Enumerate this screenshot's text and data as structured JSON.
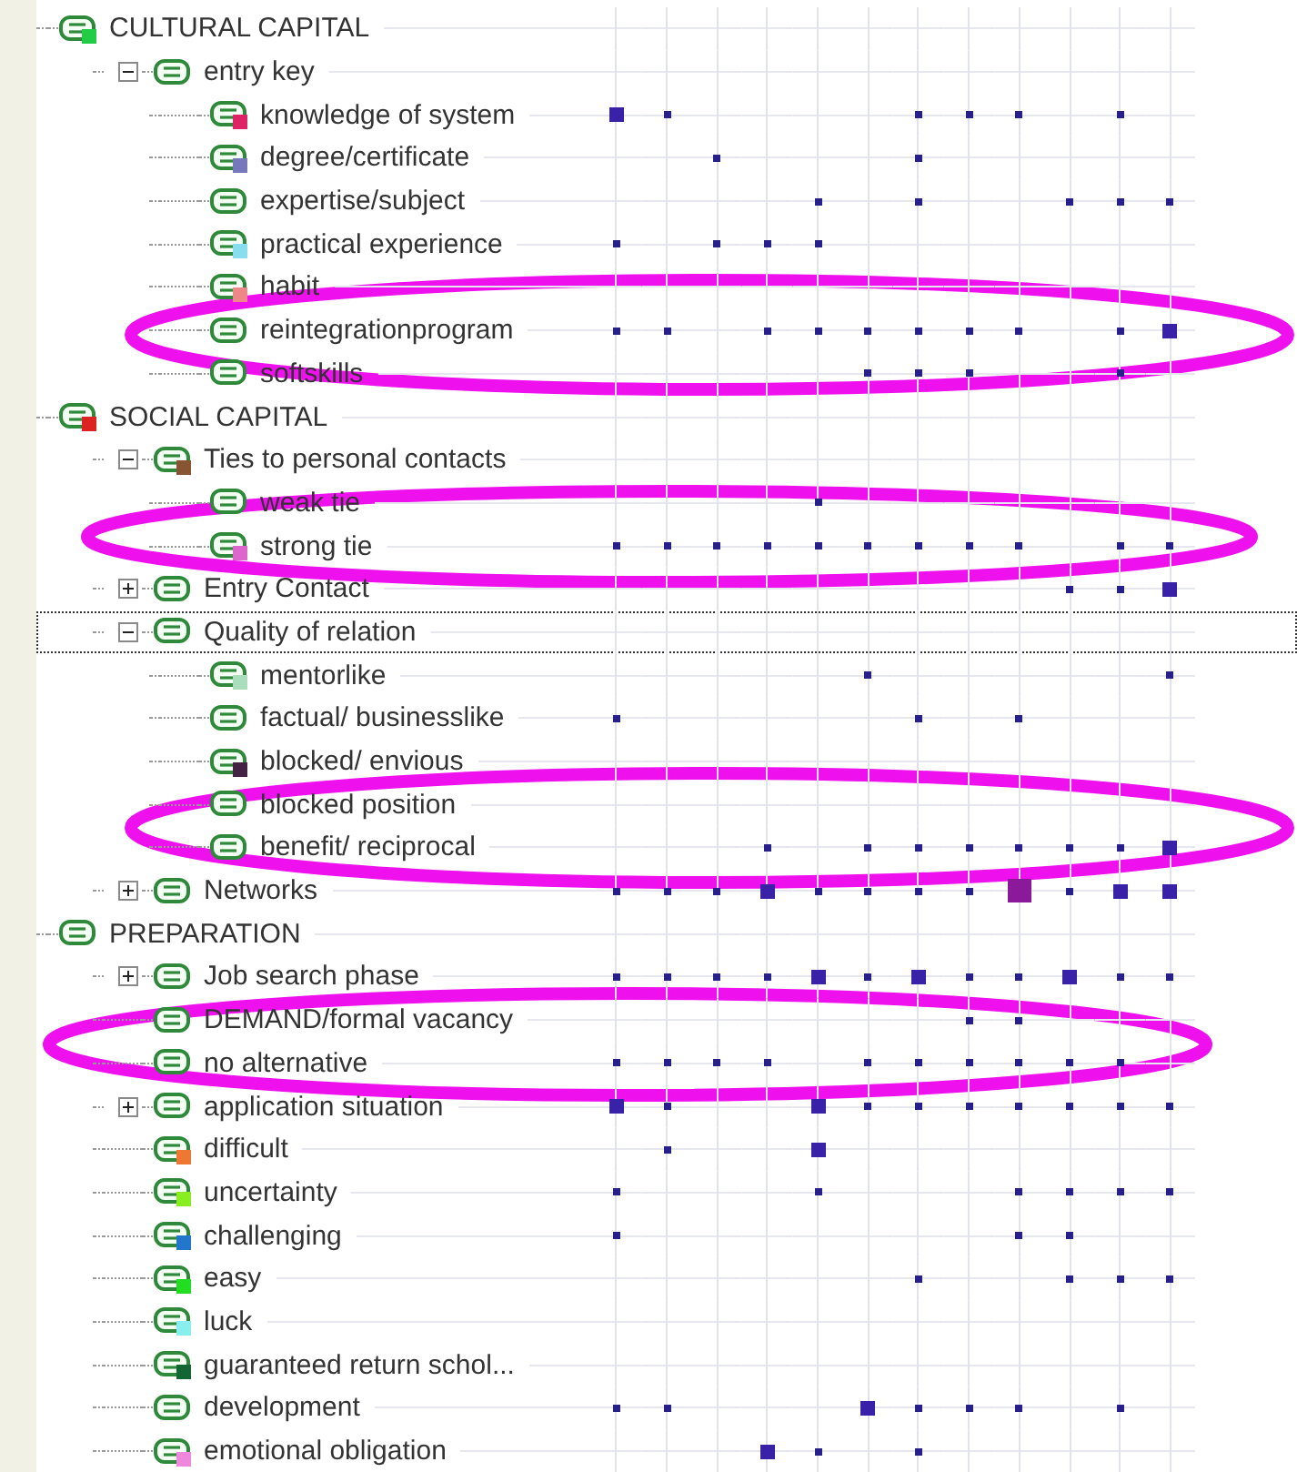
{
  "tree": [
    {
      "label": "CULTURAL CAPITAL",
      "color": "#22cc44",
      "selected": false,
      "children": [
        {
          "label": "entry key",
          "selected": false,
          "expanded": true,
          "children": [
            {
              "label": "knowledge of system",
              "color": "#dd2266",
              "selected": false,
              "cells": [
                {
                  "kind": "medium"
                },
                {
                  "kind": "small"
                },
                {
                  "kind": "none"
                },
                {
                  "kind": "none"
                },
                {
                  "kind": "none"
                },
                {
                  "kind": "none"
                },
                {
                  "kind": "small"
                },
                {
                  "kind": "small"
                },
                {
                  "kind": "small"
                },
                {
                  "kind": "none"
                },
                {
                  "kind": "small"
                },
                {
                  "kind": "none"
                }
              ]
            },
            {
              "label": "degree/certificate",
              "color": "#7777bb",
              "selected": false,
              "cells": [
                {
                  "kind": "none"
                },
                {
                  "kind": "none"
                },
                {
                  "kind": "small"
                },
                {
                  "kind": "none"
                },
                {
                  "kind": "none"
                },
                {
                  "kind": "none"
                },
                {
                  "kind": "small"
                },
                {
                  "kind": "none"
                },
                {
                  "kind": "none"
                },
                {
                  "kind": "none"
                },
                {
                  "kind": "none"
                },
                {
                  "kind": "none"
                }
              ]
            },
            {
              "label": "expertise/subject",
              "selected": false,
              "cells": [
                {
                  "kind": "none"
                },
                {
                  "kind": "none"
                },
                {
                  "kind": "none"
                },
                {
                  "kind": "none"
                },
                {
                  "kind": "small"
                },
                {
                  "kind": "none"
                },
                {
                  "kind": "small"
                },
                {
                  "kind": "none"
                },
                {
                  "kind": "none"
                },
                {
                  "kind": "small"
                },
                {
                  "kind": "small"
                },
                {
                  "kind": "small"
                }
              ]
            },
            {
              "label": "practical experience",
              "color": "#88ddee",
              "selected": false,
              "cells": [
                {
                  "kind": "small"
                },
                {
                  "kind": "none"
                },
                {
                  "kind": "small"
                },
                {
                  "kind": "small"
                },
                {
                  "kind": "small"
                },
                {
                  "kind": "none"
                },
                {
                  "kind": "none"
                },
                {
                  "kind": "none"
                },
                {
                  "kind": "none"
                },
                {
                  "kind": "none"
                },
                {
                  "kind": "none"
                },
                {
                  "kind": "none"
                }
              ]
            },
            {
              "label": "habit",
              "color": "#ee8888",
              "selected": false
            },
            {
              "label": "reintegrationprogram",
              "selected": false,
              "cells": [
                {
                  "kind": "small"
                },
                {
                  "kind": "small"
                },
                {
                  "kind": "none"
                },
                {
                  "kind": "small"
                },
                {
                  "kind": "small"
                },
                {
                  "kind": "small"
                },
                {
                  "kind": "small"
                },
                {
                  "kind": "small"
                },
                {
                  "kind": "small"
                },
                {
                  "kind": "none"
                },
                {
                  "kind": "small"
                },
                {
                  "kind": "medium"
                }
              ]
            },
            {
              "label": "softskills",
              "selected": false,
              "cells": [
                {
                  "kind": "none"
                },
                {
                  "kind": "none"
                },
                {
                  "kind": "none"
                },
                {
                  "kind": "none"
                },
                {
                  "kind": "none"
                },
                {
                  "kind": "small"
                },
                {
                  "kind": "small"
                },
                {
                  "kind": "small"
                },
                {
                  "kind": "none"
                },
                {
                  "kind": "none"
                },
                {
                  "kind": "small"
                },
                {
                  "kind": "none"
                }
              ]
            }
          ]
        }
      ]
    },
    {
      "label": "SOCIAL CAPITAL",
      "color": "#dd2222",
      "selected": false,
      "children": [
        {
          "label": "Ties to personal contacts",
          "color": "#885533",
          "selected": false,
          "expanded": true,
          "children": [
            {
              "label": "weak tie",
              "selected": false,
              "cells": [
                {
                  "kind": "none"
                },
                {
                  "kind": "none"
                },
                {
                  "kind": "none"
                },
                {
                  "kind": "none"
                },
                {
                  "kind": "small"
                },
                {
                  "kind": "none"
                },
                {
                  "kind": "none"
                },
                {
                  "kind": "none"
                },
                {
                  "kind": "none"
                },
                {
                  "kind": "none"
                },
                {
                  "kind": "none"
                },
                {
                  "kind": "none"
                }
              ]
            },
            {
              "label": "strong tie",
              "color": "#dd66cc",
              "selected": false,
              "cells": [
                {
                  "kind": "small"
                },
                {
                  "kind": "small"
                },
                {
                  "kind": "small"
                },
                {
                  "kind": "small"
                },
                {
                  "kind": "small"
                },
                {
                  "kind": "small"
                },
                {
                  "kind": "small"
                },
                {
                  "kind": "small"
                },
                {
                  "kind": "small"
                },
                {
                  "kind": "none"
                },
                {
                  "kind": "small"
                },
                {
                  "kind": "small"
                }
              ]
            }
          ]
        },
        {
          "label": "Entry Contact",
          "selected": false,
          "expanded": false,
          "cells": [
            {
              "kind": "none"
            },
            {
              "kind": "none"
            },
            {
              "kind": "none"
            },
            {
              "kind": "none"
            },
            {
              "kind": "none"
            },
            {
              "kind": "none"
            },
            {
              "kind": "none"
            },
            {
              "kind": "none"
            },
            {
              "kind": "none"
            },
            {
              "kind": "small"
            },
            {
              "kind": "small"
            },
            {
              "kind": "medium"
            }
          ]
        },
        {
          "label": "Quality of relation",
          "selected": true,
          "expanded": true,
          "children": [
            {
              "label": "mentorlike",
              "color": "#aaddbb",
              "selected": false,
              "cells": [
                {
                  "kind": "none"
                },
                {
                  "kind": "none"
                },
                {
                  "kind": "none"
                },
                {
                  "kind": "none"
                },
                {
                  "kind": "none"
                },
                {
                  "kind": "small"
                },
                {
                  "kind": "none"
                },
                {
                  "kind": "none"
                },
                {
                  "kind": "none"
                },
                {
                  "kind": "none"
                },
                {
                  "kind": "none"
                },
                {
                  "kind": "small"
                }
              ]
            },
            {
              "label": "factual/ businesslike",
              "selected": false,
              "cells": [
                {
                  "kind": "small"
                },
                {
                  "kind": "none"
                },
                {
                  "kind": "none"
                },
                {
                  "kind": "none"
                },
                {
                  "kind": "none"
                },
                {
                  "kind": "none"
                },
                {
                  "kind": "small"
                },
                {
                  "kind": "none"
                },
                {
                  "kind": "small"
                },
                {
                  "kind": "none"
                },
                {
                  "kind": "none"
                },
                {
                  "kind": "none"
                }
              ]
            },
            {
              "label": "blocked/ envious",
              "color": "#442244",
              "selected": false
            },
            {
              "label": "blocked position",
              "selected": false
            },
            {
              "label": "benefit/ reciprocal",
              "selected": false,
              "cells": [
                {
                  "kind": "none"
                },
                {
                  "kind": "none"
                },
                {
                  "kind": "none"
                },
                {
                  "kind": "small"
                },
                {
                  "kind": "none"
                },
                {
                  "kind": "small"
                },
                {
                  "kind": "small"
                },
                {
                  "kind": "small"
                },
                {
                  "kind": "small"
                },
                {
                  "kind": "small"
                },
                {
                  "kind": "small"
                },
                {
                  "kind": "medium"
                }
              ]
            }
          ]
        },
        {
          "label": "Networks",
          "selected": false,
          "expanded": false,
          "cells": [
            {
              "kind": "small"
            },
            {
              "kind": "small"
            },
            {
              "kind": "small"
            },
            {
              "kind": "medium"
            },
            {
              "kind": "small"
            },
            {
              "kind": "small"
            },
            {
              "kind": "small"
            },
            {
              "kind": "small"
            },
            {
              "kind": "large"
            },
            {
              "kind": "small"
            },
            {
              "kind": "medium"
            },
            {
              "kind": "medium"
            }
          ]
        }
      ]
    },
    {
      "label": "PREPARATION",
      "selected": false,
      "children": [
        {
          "label": "Job search phase",
          "selected": false,
          "expanded": false,
          "cells": [
            {
              "kind": "small"
            },
            {
              "kind": "small"
            },
            {
              "kind": "small"
            },
            {
              "kind": "small"
            },
            {
              "kind": "medium"
            },
            {
              "kind": "small"
            },
            {
              "kind": "medium"
            },
            {
              "kind": "small"
            },
            {
              "kind": "small"
            },
            {
              "kind": "medium"
            },
            {
              "kind": "small"
            },
            {
              "kind": "small"
            }
          ]
        },
        {
          "label": "DEMAND/formal vacancy",
          "selected": false,
          "cells": [
            {
              "kind": "none"
            },
            {
              "kind": "none"
            },
            {
              "kind": "none"
            },
            {
              "kind": "none"
            },
            {
              "kind": "none"
            },
            {
              "kind": "none"
            },
            {
              "kind": "none"
            },
            {
              "kind": "small"
            },
            {
              "kind": "small"
            },
            {
              "kind": "none"
            },
            {
              "kind": "none"
            },
            {
              "kind": "none"
            }
          ]
        },
        {
          "label": "no alternative",
          "selected": false,
          "cells": [
            {
              "kind": "small"
            },
            {
              "kind": "small"
            },
            {
              "kind": "small"
            },
            {
              "kind": "small"
            },
            {
              "kind": "none"
            },
            {
              "kind": "small"
            },
            {
              "kind": "small"
            },
            {
              "kind": "small"
            },
            {
              "kind": "small"
            },
            {
              "kind": "small"
            },
            {
              "kind": "small"
            },
            {
              "kind": "none"
            }
          ]
        },
        {
          "label": "application situation",
          "selected": false,
          "expanded": false,
          "cells": [
            {
              "kind": "medium"
            },
            {
              "kind": "small"
            },
            {
              "kind": "none"
            },
            {
              "kind": "none"
            },
            {
              "kind": "medium"
            },
            {
              "kind": "small"
            },
            {
              "kind": "small"
            },
            {
              "kind": "small"
            },
            {
              "kind": "small"
            },
            {
              "kind": "small"
            },
            {
              "kind": "small"
            },
            {
              "kind": "small"
            }
          ]
        },
        {
          "label": "difficult",
          "color": "#ee7733",
          "selected": false,
          "cells": [
            {
              "kind": "none"
            },
            {
              "kind": "small"
            },
            {
              "kind": "none"
            },
            {
              "kind": "none"
            },
            {
              "kind": "medium"
            },
            {
              "kind": "none"
            },
            {
              "kind": "none"
            },
            {
              "kind": "none"
            },
            {
              "kind": "none"
            },
            {
              "kind": "none"
            },
            {
              "kind": "none"
            },
            {
              "kind": "none"
            }
          ]
        },
        {
          "label": "uncertainty",
          "color": "#88ee22",
          "selected": false,
          "cells": [
            {
              "kind": "small"
            },
            {
              "kind": "none"
            },
            {
              "kind": "none"
            },
            {
              "kind": "none"
            },
            {
              "kind": "small"
            },
            {
              "kind": "none"
            },
            {
              "kind": "none"
            },
            {
              "kind": "none"
            },
            {
              "kind": "small"
            },
            {
              "kind": "small"
            },
            {
              "kind": "small"
            },
            {
              "kind": "small"
            }
          ]
        },
        {
          "label": "challenging",
          "color": "#2277cc",
          "selected": false,
          "cells": [
            {
              "kind": "small"
            },
            {
              "kind": "none"
            },
            {
              "kind": "none"
            },
            {
              "kind": "none"
            },
            {
              "kind": "none"
            },
            {
              "kind": "none"
            },
            {
              "kind": "none"
            },
            {
              "kind": "none"
            },
            {
              "kind": "small"
            },
            {
              "kind": "small"
            },
            {
              "kind": "none"
            },
            {
              "kind": "none"
            }
          ]
        },
        {
          "label": "easy",
          "color": "#22dd22",
          "selected": false,
          "cells": [
            {
              "kind": "none"
            },
            {
              "kind": "none"
            },
            {
              "kind": "none"
            },
            {
              "kind": "none"
            },
            {
              "kind": "none"
            },
            {
              "kind": "none"
            },
            {
              "kind": "small"
            },
            {
              "kind": "none"
            },
            {
              "kind": "none"
            },
            {
              "kind": "small"
            },
            {
              "kind": "small"
            },
            {
              "kind": "small"
            }
          ]
        },
        {
          "label": "luck",
          "color": "#88eeee",
          "selected": false
        },
        {
          "label": "guaranteed return schol...",
          "color": "#116633",
          "selected": false
        },
        {
          "label": "development",
          "selected": false,
          "cells": [
            {
              "kind": "small"
            },
            {
              "kind": "small"
            },
            {
              "kind": "none"
            },
            {
              "kind": "none"
            },
            {
              "kind": "none"
            },
            {
              "kind": "medium"
            },
            {
              "kind": "small"
            },
            {
              "kind": "small"
            },
            {
              "kind": "small"
            },
            {
              "kind": "none"
            },
            {
              "kind": "small"
            },
            {
              "kind": "none"
            }
          ]
        },
        {
          "label": "emotional obligation",
          "color": "#ee88dd",
          "selected": false,
          "cells": [
            {
              "kind": "none"
            },
            {
              "kind": "none"
            },
            {
              "kind": "none"
            },
            {
              "kind": "medium"
            },
            {
              "kind": "small"
            },
            {
              "kind": "none"
            },
            {
              "kind": "small"
            },
            {
              "kind": "none"
            },
            {
              "kind": "none"
            },
            {
              "kind": "none"
            },
            {
              "kind": "none"
            },
            {
              "kind": "none"
            }
          ]
        }
      ]
    }
  ]
}
